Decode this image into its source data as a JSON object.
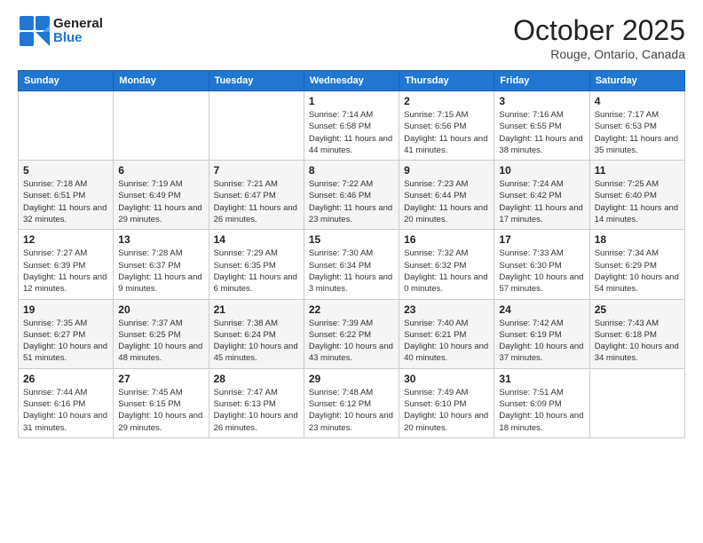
{
  "header": {
    "logo_line1": "General",
    "logo_line2": "Blue",
    "month_title": "October 2025",
    "location": "Rouge, Ontario, Canada"
  },
  "days_of_week": [
    "Sunday",
    "Monday",
    "Tuesday",
    "Wednesday",
    "Thursday",
    "Friday",
    "Saturday"
  ],
  "weeks": [
    [
      {
        "day": "",
        "info": ""
      },
      {
        "day": "",
        "info": ""
      },
      {
        "day": "",
        "info": ""
      },
      {
        "day": "1",
        "info": "Sunrise: 7:14 AM\nSunset: 6:58 PM\nDaylight: 11 hours and 44 minutes."
      },
      {
        "day": "2",
        "info": "Sunrise: 7:15 AM\nSunset: 6:56 PM\nDaylight: 11 hours and 41 minutes."
      },
      {
        "day": "3",
        "info": "Sunrise: 7:16 AM\nSunset: 6:55 PM\nDaylight: 11 hours and 38 minutes."
      },
      {
        "day": "4",
        "info": "Sunrise: 7:17 AM\nSunset: 6:53 PM\nDaylight: 11 hours and 35 minutes."
      }
    ],
    [
      {
        "day": "5",
        "info": "Sunrise: 7:18 AM\nSunset: 6:51 PM\nDaylight: 11 hours and 32 minutes."
      },
      {
        "day": "6",
        "info": "Sunrise: 7:19 AM\nSunset: 6:49 PM\nDaylight: 11 hours and 29 minutes."
      },
      {
        "day": "7",
        "info": "Sunrise: 7:21 AM\nSunset: 6:47 PM\nDaylight: 11 hours and 26 minutes."
      },
      {
        "day": "8",
        "info": "Sunrise: 7:22 AM\nSunset: 6:46 PM\nDaylight: 11 hours and 23 minutes."
      },
      {
        "day": "9",
        "info": "Sunrise: 7:23 AM\nSunset: 6:44 PM\nDaylight: 11 hours and 20 minutes."
      },
      {
        "day": "10",
        "info": "Sunrise: 7:24 AM\nSunset: 6:42 PM\nDaylight: 11 hours and 17 minutes."
      },
      {
        "day": "11",
        "info": "Sunrise: 7:25 AM\nSunset: 6:40 PM\nDaylight: 11 hours and 14 minutes."
      }
    ],
    [
      {
        "day": "12",
        "info": "Sunrise: 7:27 AM\nSunset: 6:39 PM\nDaylight: 11 hours and 12 minutes."
      },
      {
        "day": "13",
        "info": "Sunrise: 7:28 AM\nSunset: 6:37 PM\nDaylight: 11 hours and 9 minutes."
      },
      {
        "day": "14",
        "info": "Sunrise: 7:29 AM\nSunset: 6:35 PM\nDaylight: 11 hours and 6 minutes."
      },
      {
        "day": "15",
        "info": "Sunrise: 7:30 AM\nSunset: 6:34 PM\nDaylight: 11 hours and 3 minutes."
      },
      {
        "day": "16",
        "info": "Sunrise: 7:32 AM\nSunset: 6:32 PM\nDaylight: 11 hours and 0 minutes."
      },
      {
        "day": "17",
        "info": "Sunrise: 7:33 AM\nSunset: 6:30 PM\nDaylight: 10 hours and 57 minutes."
      },
      {
        "day": "18",
        "info": "Sunrise: 7:34 AM\nSunset: 6:29 PM\nDaylight: 10 hours and 54 minutes."
      }
    ],
    [
      {
        "day": "19",
        "info": "Sunrise: 7:35 AM\nSunset: 6:27 PM\nDaylight: 10 hours and 51 minutes."
      },
      {
        "day": "20",
        "info": "Sunrise: 7:37 AM\nSunset: 6:25 PM\nDaylight: 10 hours and 48 minutes."
      },
      {
        "day": "21",
        "info": "Sunrise: 7:38 AM\nSunset: 6:24 PM\nDaylight: 10 hours and 45 minutes."
      },
      {
        "day": "22",
        "info": "Sunrise: 7:39 AM\nSunset: 6:22 PM\nDaylight: 10 hours and 43 minutes."
      },
      {
        "day": "23",
        "info": "Sunrise: 7:40 AM\nSunset: 6:21 PM\nDaylight: 10 hours and 40 minutes."
      },
      {
        "day": "24",
        "info": "Sunrise: 7:42 AM\nSunset: 6:19 PM\nDaylight: 10 hours and 37 minutes."
      },
      {
        "day": "25",
        "info": "Sunrise: 7:43 AM\nSunset: 6:18 PM\nDaylight: 10 hours and 34 minutes."
      }
    ],
    [
      {
        "day": "26",
        "info": "Sunrise: 7:44 AM\nSunset: 6:16 PM\nDaylight: 10 hours and 31 minutes."
      },
      {
        "day": "27",
        "info": "Sunrise: 7:45 AM\nSunset: 6:15 PM\nDaylight: 10 hours and 29 minutes."
      },
      {
        "day": "28",
        "info": "Sunrise: 7:47 AM\nSunset: 6:13 PM\nDaylight: 10 hours and 26 minutes."
      },
      {
        "day": "29",
        "info": "Sunrise: 7:48 AM\nSunset: 6:12 PM\nDaylight: 10 hours and 23 minutes."
      },
      {
        "day": "30",
        "info": "Sunrise: 7:49 AM\nSunset: 6:10 PM\nDaylight: 10 hours and 20 minutes."
      },
      {
        "day": "31",
        "info": "Sunrise: 7:51 AM\nSunset: 6:09 PM\nDaylight: 10 hours and 18 minutes."
      },
      {
        "day": "",
        "info": ""
      }
    ]
  ]
}
